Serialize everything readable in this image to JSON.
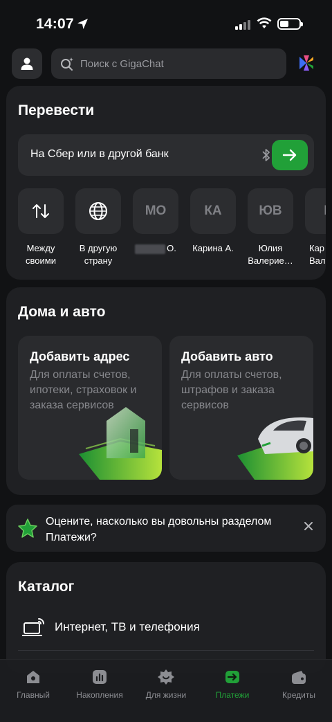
{
  "status_bar": {
    "time": "14:07"
  },
  "search": {
    "placeholder": "Поиск с GigaChat"
  },
  "transfer": {
    "title": "Перевести",
    "input_label": "На Сбер или в другой банк",
    "contacts": [
      {
        "initials": "",
        "line1": "Между",
        "line2": "своими"
      },
      {
        "initials": "",
        "line1": "В другую",
        "line2": "страну"
      },
      {
        "initials": "МО",
        "line1": "О.",
        "line2": ""
      },
      {
        "initials": "КА",
        "line1": "Карина А.",
        "line2": ""
      },
      {
        "initials": "ЮВ",
        "line1": "Юлия",
        "line2": "Валерие…"
      },
      {
        "initials": "К",
        "line1": "Кар",
        "line2": "Вале"
      }
    ]
  },
  "home_auto": {
    "title": "Дома и авто",
    "tiles": [
      {
        "title": "Добавить адрес",
        "subtitle": "Для оплаты счетов, ипотеки, страховок и заказа сервисов"
      },
      {
        "title": "Добавить авто",
        "subtitle": "Для оплаты счетов, штрафов и заказа сервисов"
      }
    ]
  },
  "rating": {
    "text": "Оцените, насколько вы довольны разделом Платежи?"
  },
  "catalog": {
    "title": "Каталог",
    "items": [
      {
        "label": "Интернет, ТВ и телефония"
      }
    ]
  },
  "tabs": [
    {
      "label": "Главный",
      "icon": "home-icon",
      "active": false
    },
    {
      "label": "Накопления",
      "icon": "savings-chart-icon",
      "active": false
    },
    {
      "label": "Для жизни",
      "icon": "lifestyle-icon",
      "active": false
    },
    {
      "label": "Платежи",
      "icon": "payments-icon",
      "active": true
    },
    {
      "label": "Кредиты",
      "icon": "wallet-icon",
      "active": false
    }
  ],
  "colors": {
    "accent": "#21a038",
    "background": "#111214",
    "card": "#1f2023"
  }
}
